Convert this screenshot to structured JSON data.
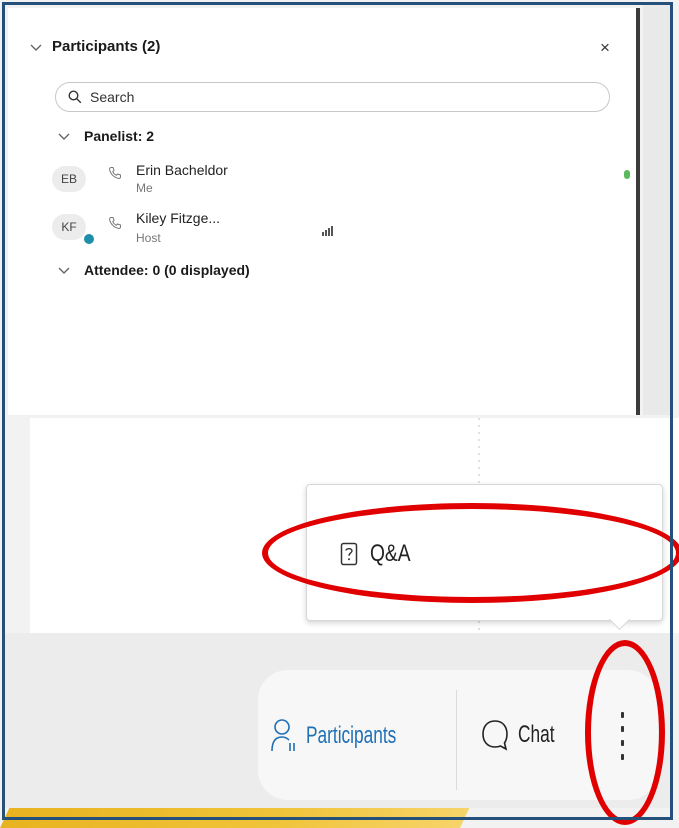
{
  "participants_panel": {
    "title": "Participants (2)",
    "close_label": "×",
    "search_placeholder": "Search",
    "panelist_section": "Panelist: 2",
    "attendee_section": "Attendee: 0 (0 displayed)",
    "panelists": [
      {
        "initials": "EB",
        "name": "Erin Bacheldor",
        "role": "Me"
      },
      {
        "initials": "KF",
        "name": "Kiley Fitzge...",
        "role": "Host"
      }
    ]
  },
  "more_menu": {
    "items": [
      {
        "label": "Q&A",
        "icon": "question-icon"
      }
    ]
  },
  "toolbar": {
    "participants_label": "Participants",
    "chat_label": "Chat",
    "more_icon": "more-vertical-icon"
  },
  "colors": {
    "accent": "#1f6fb5",
    "annotation": "#e00000",
    "frame_border": "#24507a",
    "yellow_strip": "#e8b320",
    "mic_active": "#5cb85c"
  }
}
